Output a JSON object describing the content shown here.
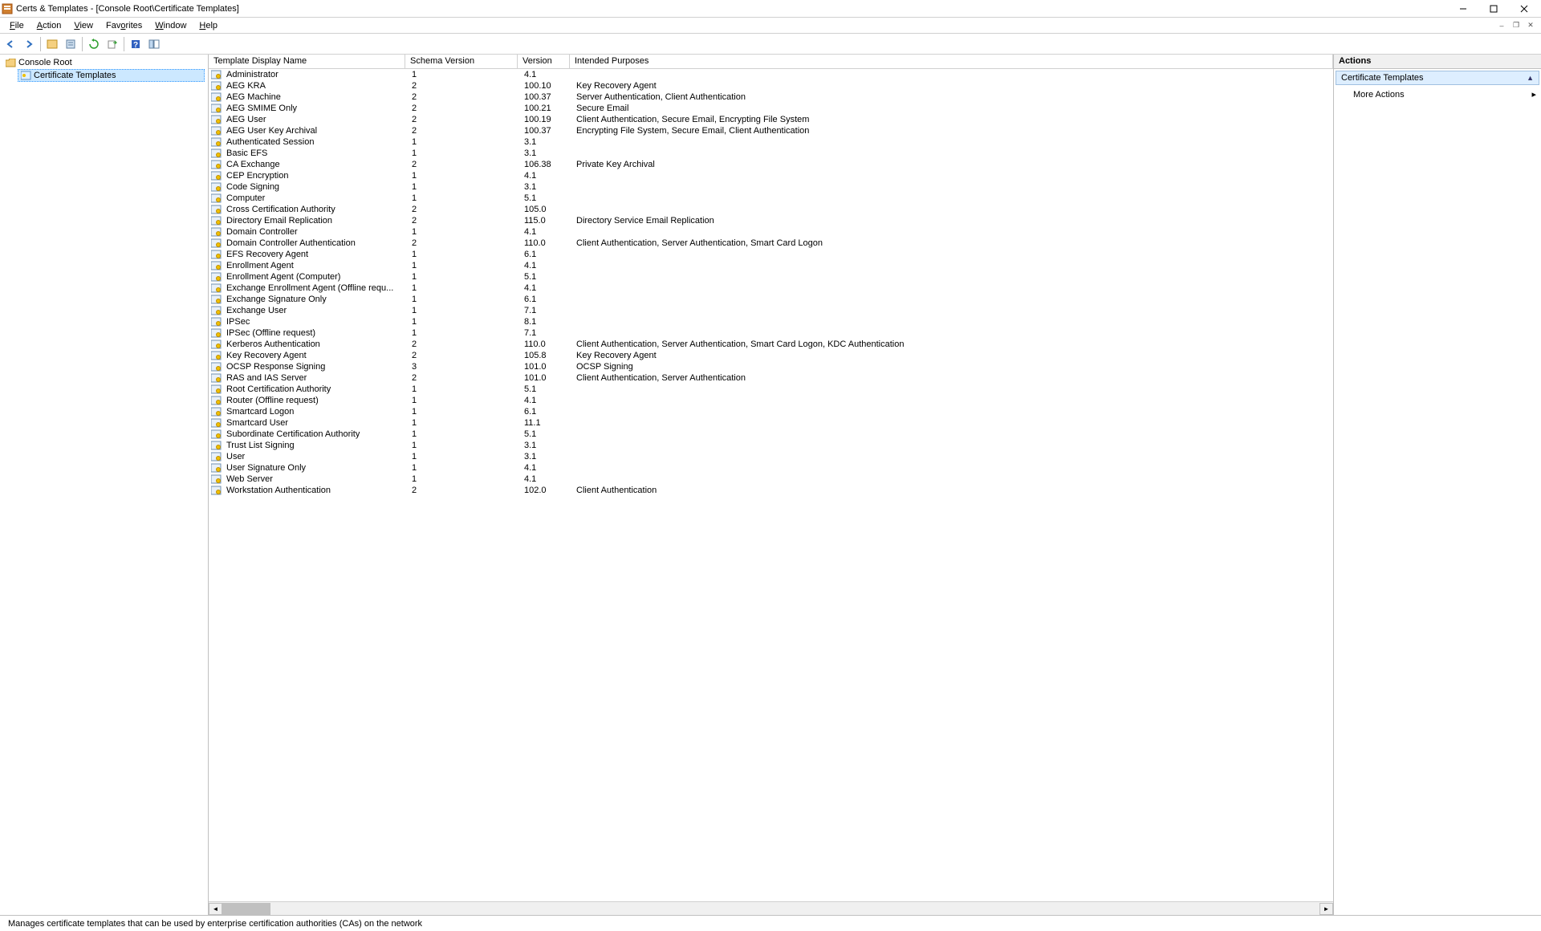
{
  "window": {
    "title": "Certs & Templates - [Console Root\\Certificate Templates]"
  },
  "menu": {
    "file": "File",
    "action": "Action",
    "view": "View",
    "favorites": "Favorites",
    "window": "Window",
    "help": "Help"
  },
  "tree": {
    "root": "Console Root",
    "child": "Certificate Templates"
  },
  "columns": {
    "name": "Template Display Name",
    "schema": "Schema Version",
    "version": "Version",
    "purpose": "Intended Purposes"
  },
  "rows": [
    {
      "name": "Administrator",
      "schema": "1",
      "version": "4.1",
      "purpose": ""
    },
    {
      "name": "AEG KRA",
      "schema": "2",
      "version": "100.10",
      "purpose": "Key Recovery Agent"
    },
    {
      "name": "AEG Machine",
      "schema": "2",
      "version": "100.37",
      "purpose": "Server Authentication, Client Authentication"
    },
    {
      "name": "AEG SMIME Only",
      "schema": "2",
      "version": "100.21",
      "purpose": "Secure Email"
    },
    {
      "name": "AEG User",
      "schema": "2",
      "version": "100.19",
      "purpose": "Client Authentication, Secure Email, Encrypting File System"
    },
    {
      "name": "AEG User Key Archival",
      "schema": "2",
      "version": "100.37",
      "purpose": "Encrypting File System, Secure Email, Client Authentication"
    },
    {
      "name": "Authenticated Session",
      "schema": "1",
      "version": "3.1",
      "purpose": ""
    },
    {
      "name": "Basic EFS",
      "schema": "1",
      "version": "3.1",
      "purpose": ""
    },
    {
      "name": "CA Exchange",
      "schema": "2",
      "version": "106.38",
      "purpose": "Private Key Archival"
    },
    {
      "name": "CEP Encryption",
      "schema": "1",
      "version": "4.1",
      "purpose": ""
    },
    {
      "name": "Code Signing",
      "schema": "1",
      "version": "3.1",
      "purpose": ""
    },
    {
      "name": "Computer",
      "schema": "1",
      "version": "5.1",
      "purpose": ""
    },
    {
      "name": "Cross Certification Authority",
      "schema": "2",
      "version": "105.0",
      "purpose": ""
    },
    {
      "name": "Directory Email Replication",
      "schema": "2",
      "version": "115.0",
      "purpose": "Directory Service Email Replication"
    },
    {
      "name": "Domain Controller",
      "schema": "1",
      "version": "4.1",
      "purpose": ""
    },
    {
      "name": "Domain Controller Authentication",
      "schema": "2",
      "version": "110.0",
      "purpose": "Client Authentication, Server Authentication, Smart Card Logon"
    },
    {
      "name": "EFS Recovery Agent",
      "schema": "1",
      "version": "6.1",
      "purpose": ""
    },
    {
      "name": "Enrollment Agent",
      "schema": "1",
      "version": "4.1",
      "purpose": ""
    },
    {
      "name": "Enrollment Agent (Computer)",
      "schema": "1",
      "version": "5.1",
      "purpose": ""
    },
    {
      "name": "Exchange Enrollment Agent (Offline requ...",
      "schema": "1",
      "version": "4.1",
      "purpose": ""
    },
    {
      "name": "Exchange Signature Only",
      "schema": "1",
      "version": "6.1",
      "purpose": ""
    },
    {
      "name": "Exchange User",
      "schema": "1",
      "version": "7.1",
      "purpose": ""
    },
    {
      "name": "IPSec",
      "schema": "1",
      "version": "8.1",
      "purpose": ""
    },
    {
      "name": "IPSec (Offline request)",
      "schema": "1",
      "version": "7.1",
      "purpose": ""
    },
    {
      "name": "Kerberos Authentication",
      "schema": "2",
      "version": "110.0",
      "purpose": "Client Authentication, Server Authentication, Smart Card Logon, KDC Authentication"
    },
    {
      "name": "Key Recovery Agent",
      "schema": "2",
      "version": "105.8",
      "purpose": "Key Recovery Agent"
    },
    {
      "name": "OCSP Response Signing",
      "schema": "3",
      "version": "101.0",
      "purpose": "OCSP Signing"
    },
    {
      "name": "RAS and IAS Server",
      "schema": "2",
      "version": "101.0",
      "purpose": "Client Authentication, Server Authentication"
    },
    {
      "name": "Root Certification Authority",
      "schema": "1",
      "version": "5.1",
      "purpose": ""
    },
    {
      "name": "Router (Offline request)",
      "schema": "1",
      "version": "4.1",
      "purpose": ""
    },
    {
      "name": "Smartcard Logon",
      "schema": "1",
      "version": "6.1",
      "purpose": ""
    },
    {
      "name": "Smartcard User",
      "schema": "1",
      "version": "11.1",
      "purpose": ""
    },
    {
      "name": "Subordinate Certification Authority",
      "schema": "1",
      "version": "5.1",
      "purpose": ""
    },
    {
      "name": "Trust List Signing",
      "schema": "1",
      "version": "3.1",
      "purpose": ""
    },
    {
      "name": "User",
      "schema": "1",
      "version": "3.1",
      "purpose": ""
    },
    {
      "name": "User Signature Only",
      "schema": "1",
      "version": "4.1",
      "purpose": ""
    },
    {
      "name": "Web Server",
      "schema": "1",
      "version": "4.1",
      "purpose": ""
    },
    {
      "name": "Workstation Authentication",
      "schema": "2",
      "version": "102.0",
      "purpose": "Client Authentication"
    }
  ],
  "actions": {
    "header": "Actions",
    "group": "Certificate Templates",
    "more": "More Actions"
  },
  "status": "Manages certificate templates that can be used by enterprise certification authorities (CAs) on the network"
}
